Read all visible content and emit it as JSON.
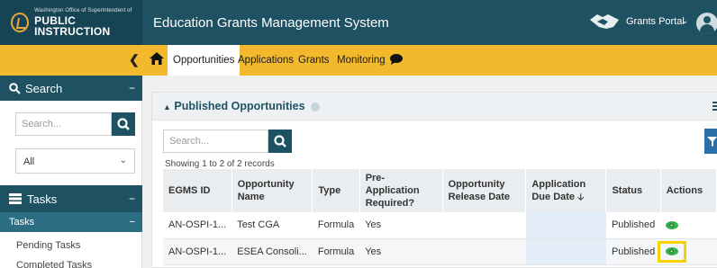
{
  "header": {
    "org_small": "Washington Office of Superintendent of",
    "org_big": "PUBLIC INSTRUCTION",
    "app_title": "Education Grants Management System",
    "portal_label": "Grants Portal",
    "portal_chevron": "⌄"
  },
  "nav": {
    "collapse": "❮",
    "tabs": [
      "Opportunities",
      "Applications",
      "Grants",
      "Monitoring"
    ],
    "active_tab": "Opportunities"
  },
  "sidebar": {
    "search_title": "Search",
    "search_placeholder": "Search...",
    "select_value": "All",
    "select_chevron": "⌄",
    "tasks_title": "Tasks",
    "tasks_sub": "Tasks",
    "minus": "−",
    "links": [
      "Pending Tasks",
      "Completed Tasks"
    ]
  },
  "main": {
    "panel_title": "Published Opportunities",
    "panel_caret": "▲",
    "search_placeholder": "Search...",
    "showing": "Showing 1 to 2 of 2 records",
    "columns": [
      "EGMS ID",
      "Opportunity Name",
      "Type",
      "Pre-Application Required?",
      "Opportunity Release Date",
      "Application Due Date",
      "Status",
      "Actions"
    ],
    "sort_arrow": "🡣",
    "rows": [
      {
        "id": "AN-OSPI-1...",
        "name": "Test CGA",
        "type": "Formula",
        "pre_app": "Yes",
        "release": "",
        "due": "",
        "status": "Published"
      },
      {
        "id": "AN-OSPI-1...",
        "name": "ESEA Consoli...",
        "type": "Formula",
        "pre_app": "Yes",
        "release": "",
        "due": "",
        "status": "Published"
      }
    ]
  },
  "colors": {
    "header_teal": "#1e5263",
    "nav_yellow": "#f2b92c",
    "view_green": "#35b04a",
    "highlight_yellow": "#f5d200"
  }
}
